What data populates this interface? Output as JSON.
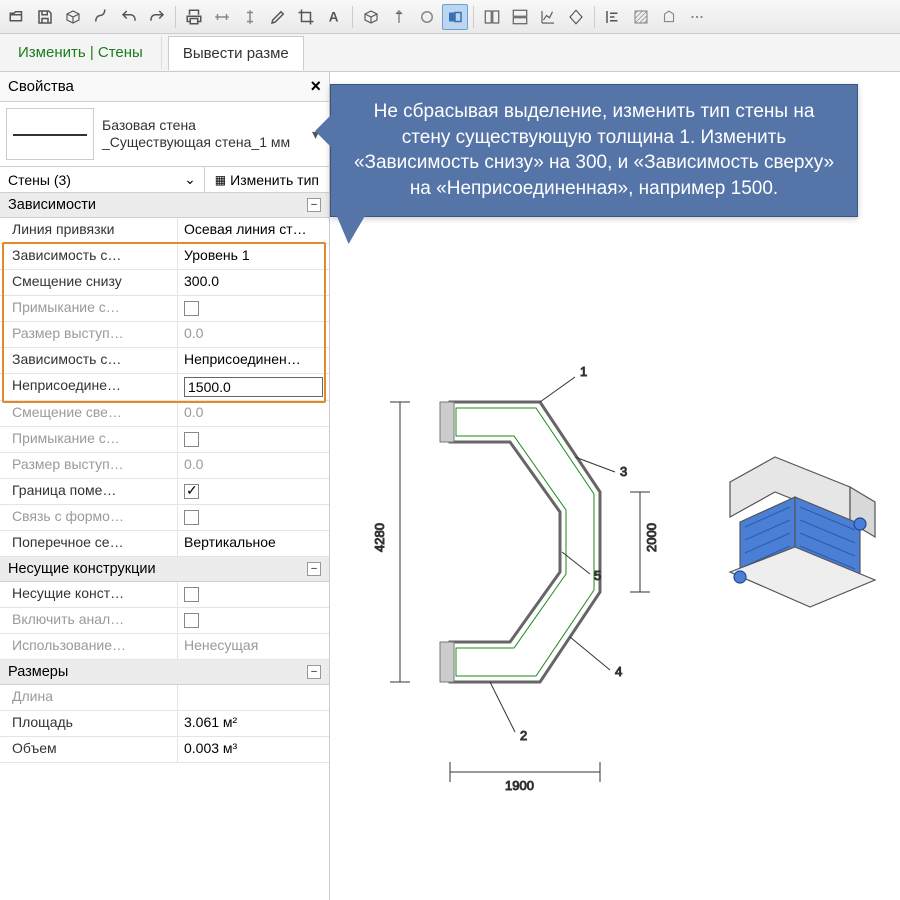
{
  "toolbar": [
    "open",
    "save",
    "cube",
    "pipe",
    "undo",
    "redo",
    "sep",
    "print",
    "align-h",
    "align-v",
    "pencil",
    "crop",
    "text",
    "sep",
    "cube2",
    "arrow",
    "circle",
    "half",
    "sep",
    "split1",
    "split2",
    "graph",
    "diamond",
    "sep",
    "align-left",
    "hatch",
    "shape",
    "more"
  ],
  "toolbar_active": "half",
  "ribbon": {
    "tab1": "Изменить | Стены",
    "tab2": "Вывести разме"
  },
  "panel": {
    "title": "Свойства",
    "type_name": "Базовая стена\n_Существующая стена_1 мм",
    "instance_label": "Стены (3)",
    "edit_type": "Изменить тип"
  },
  "categories": {
    "constraints": "Зависимости",
    "structural": "Несущие конструкции",
    "dimensions": "Размеры"
  },
  "props": {
    "c": [
      {
        "n": "Линия привязки",
        "v": "Осевая линия ст…"
      },
      {
        "n": "Зависимость с…",
        "v": "Уровень 1"
      },
      {
        "n": "Смещение снизу",
        "v": "300.0"
      },
      {
        "n": "Примыкание с…",
        "v": "",
        "chk": true,
        "dis": true
      },
      {
        "n": "Размер выступ…",
        "v": "0.0",
        "dis": true
      },
      {
        "n": "Зависимость с…",
        "v": "Неприсоединен…"
      },
      {
        "n": "Неприсоедине…",
        "v": "1500.0",
        "edit": true
      },
      {
        "n": "Смещение све…",
        "v": "0.0",
        "dis": true
      },
      {
        "n": "Примыкание с…",
        "v": "",
        "chk": true,
        "dis": true
      },
      {
        "n": "Размер выступ…",
        "v": "0.0",
        "dis": true
      },
      {
        "n": "Граница поме…",
        "v": "",
        "chk": true,
        "on": true
      },
      {
        "n": "Связь с формо…",
        "v": "",
        "chk": true,
        "dis": true
      },
      {
        "n": "Поперечное се…",
        "v": "Вертикальное"
      }
    ],
    "s": [
      {
        "n": "Несущие конст…",
        "v": "",
        "chk": true
      },
      {
        "n": "Включить анал…",
        "v": "",
        "chk": true,
        "dis": true
      },
      {
        "n": "Использование…",
        "v": "Ненесущая",
        "dis": true
      }
    ],
    "d": [
      {
        "n": "Длина",
        "v": "",
        "dis": true
      },
      {
        "n": "Площадь",
        "v": "3.061 м²"
      },
      {
        "n": "Объем",
        "v": "0.003 м³"
      }
    ]
  },
  "callout": "Не сбрасывая выделение, изменить тип стены на стену существующую толщина 1. Изменить «Зависимость снизу» на 300, и «Зависимость сверху» на «Неприсоединенная», например 1500.",
  "plan": {
    "dims": {
      "w": "1900",
      "h_left": "4280",
      "h_right": "2000"
    },
    "tags": [
      "1",
      "2",
      "3",
      "4",
      "5"
    ]
  }
}
